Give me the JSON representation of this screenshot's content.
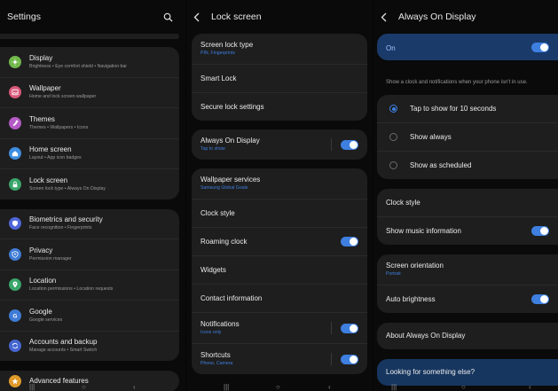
{
  "settings": {
    "title": "Settings",
    "search_icon": "search-icon",
    "groups": [
      [
        {
          "label": "Display",
          "sub": "Brightness • Eye comfort shield • Navigation bar",
          "color": "#71b84b",
          "icon": "sun-icon"
        },
        {
          "label": "Wallpaper",
          "sub": "Home and lock screen wallpaper",
          "color": "#d9587a",
          "icon": "image-icon"
        },
        {
          "label": "Themes",
          "sub": "Themes • Wallpapers • Icons",
          "color": "#b45ac4",
          "icon": "brush-icon"
        },
        {
          "label": "Home screen",
          "sub": "Layout • App icon badges",
          "color": "#3f8de0",
          "icon": "home-icon"
        },
        {
          "label": "Lock screen",
          "sub": "Screen lock type • Always On Display",
          "color": "#3aa56a",
          "icon": "lock-icon"
        }
      ],
      [
        {
          "label": "Biometrics and security",
          "sub": "Face recognition • Fingerprints",
          "color": "#4f66d9",
          "icon": "shield-icon"
        },
        {
          "label": "Privacy",
          "sub": "Permission manager",
          "color": "#3f7bd6",
          "icon": "privacy-icon"
        },
        {
          "label": "Location",
          "sub": "Location permissions • Location requests",
          "color": "#3aa56a",
          "icon": "location-icon"
        },
        {
          "label": "Google",
          "sub": "Google services",
          "color": "#3f7bd6",
          "icon": "google-icon"
        },
        {
          "label": "Accounts and backup",
          "sub": "Manage accounts • Smart Switch",
          "color": "#4566d0",
          "icon": "sync-icon"
        }
      ],
      [
        {
          "label": "Advanced features",
          "sub": "",
          "color": "#e09a2a",
          "icon": "star-icon"
        }
      ]
    ]
  },
  "lock_screen": {
    "title": "Lock screen",
    "groups": [
      [
        {
          "label": "Screen lock type",
          "sub": "PIN, Fingerprints",
          "sub_blue": true,
          "toggle": false
        },
        {
          "label": "Smart Lock",
          "sub": "",
          "toggle": false
        },
        {
          "label": "Secure lock settings",
          "sub": "",
          "toggle": false
        }
      ],
      [
        {
          "label": "Always On Display",
          "sub": "Tap to show",
          "sub_blue": true,
          "toggle": true
        }
      ],
      [
        {
          "label": "Wallpaper services",
          "sub": "Samsung Global Goals",
          "sub_blue": true,
          "toggle": false
        },
        {
          "label": "Clock style",
          "sub": "",
          "toggle": false
        },
        {
          "label": "Roaming clock",
          "sub": "",
          "toggle": true
        },
        {
          "label": "Widgets",
          "sub": "",
          "toggle": false
        },
        {
          "label": "Contact information",
          "sub": "",
          "toggle": false
        },
        {
          "label": "Notifications",
          "sub": "Icons only",
          "sub_blue": true,
          "toggle": true
        },
        {
          "label": "Shortcuts",
          "sub": "Phone, Camera",
          "sub_blue": true,
          "toggle": true
        }
      ]
    ]
  },
  "aod": {
    "title": "Always On Display",
    "on_label": "On",
    "description": "Show a clock and notifications when your phone isn't in use.",
    "options": [
      {
        "label": "Tap to show for 10 seconds",
        "selected": true
      },
      {
        "label": "Show always",
        "selected": false
      },
      {
        "label": "Show as scheduled",
        "selected": false
      }
    ],
    "group2": [
      {
        "label": "Clock style",
        "toggle": false
      },
      {
        "label": "Show music information",
        "toggle": true
      }
    ],
    "group3": [
      {
        "label": "Screen orientation",
        "sub": "Portrait",
        "toggle": false
      },
      {
        "label": "Auto brightness",
        "toggle": true
      }
    ],
    "about": "About Always On Display",
    "looking": "Looking for something else?"
  },
  "colors": {
    "accent": "#3e7fe0",
    "card": "#1e1e1e",
    "background": "#0a0a0a"
  }
}
